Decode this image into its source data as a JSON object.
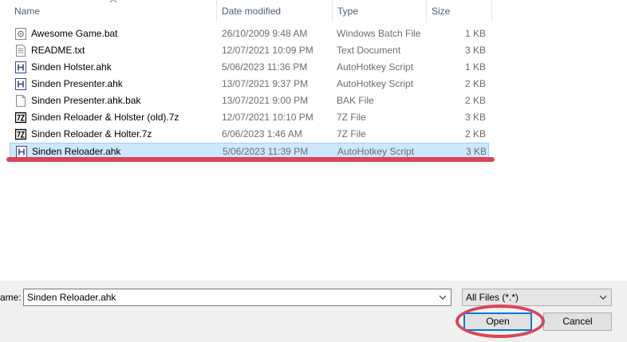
{
  "columns": {
    "name": "Name",
    "date": "Date modified",
    "type": "Type",
    "size": "Size"
  },
  "files": [
    {
      "name": "Awesome Game.bat",
      "date": "26/10/2009 9:48 AM",
      "type": "Windows Batch File",
      "size": "1 KB",
      "icon": "batch-file-icon",
      "selected": false
    },
    {
      "name": "README.txt",
      "date": "12/07/2021 10:09 PM",
      "type": "Text Document",
      "size": "3 KB",
      "icon": "text-file-icon",
      "selected": false
    },
    {
      "name": "Sinden Holster.ahk",
      "date": "5/06/2023 11:36 PM",
      "type": "AutoHotkey Script",
      "size": "1 KB",
      "icon": "autohotkey-file-icon",
      "selected": false
    },
    {
      "name": "Sinden Presenter.ahk",
      "date": "13/07/2021 9:37 PM",
      "type": "AutoHotkey Script",
      "size": "2 KB",
      "icon": "autohotkey-file-icon",
      "selected": false
    },
    {
      "name": "Sinden Presenter.ahk.bak",
      "date": "13/07/2021 9:00 PM",
      "type": "BAK File",
      "size": "2 KB",
      "icon": "generic-file-icon",
      "selected": false
    },
    {
      "name": "Sinden Reloader & Holster (old).7z",
      "date": "12/07/2021 10:10 PM",
      "type": "7Z File",
      "size": "3 KB",
      "icon": "7z-archive-icon",
      "selected": false
    },
    {
      "name": "Sinden Reloader & Holter.7z",
      "date": "6/06/2023 1:46 AM",
      "type": "7Z File",
      "size": "2 KB",
      "icon": "7z-archive-icon",
      "selected": false
    },
    {
      "name": "Sinden Reloader.ahk",
      "date": "5/06/2023 11:39 PM",
      "type": "AutoHotkey Script",
      "size": "3 KB",
      "icon": "autohotkey-file-icon",
      "selected": true
    }
  ],
  "footer": {
    "filename_label": "ame:",
    "filename_value": "Sinden Reloader.ahk",
    "filter_value": "All Files (*.*)",
    "open_label": "Open",
    "cancel_label": "Cancel"
  },
  "colors": {
    "selection": "#cce8ff",
    "annotation": "#d9455a",
    "accent": "#0078d7"
  }
}
